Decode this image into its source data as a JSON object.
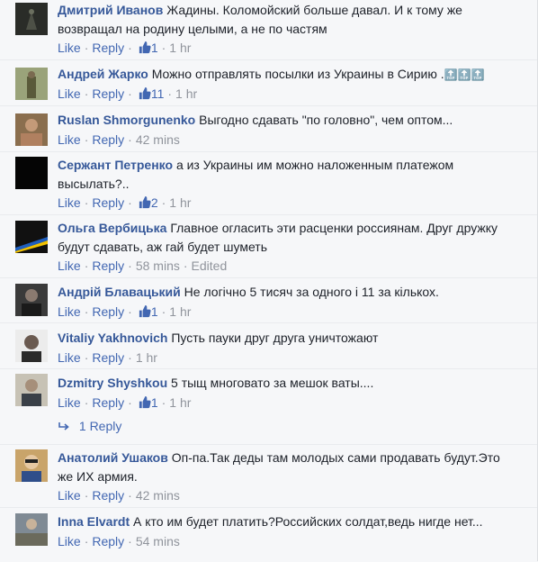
{
  "comments": [
    {
      "author": "Дмитрий Иванов",
      "text": "Жадины. Коломойский больше давал. И к тому же возвращал на родину целыми, а не по частям",
      "like": "Like",
      "reply": "Reply",
      "likes": "1",
      "time": "1 hr"
    },
    {
      "author": "Андрей Жарко",
      "text": "Можно отправлять посылки из Украины в Сирию .",
      "emoji": "🔝🔝🔝",
      "like": "Like",
      "reply": "Reply",
      "likes": "11",
      "time": "1 hr"
    },
    {
      "author": "Ruslan Shmorgunenko",
      "text": "Выгодно сдавать \"по головно\", чем оптом...",
      "like": "Like",
      "reply": "Reply",
      "time": "42 mins"
    },
    {
      "author": "Сержант Петренко",
      "text": "а из Украины им можно наложенным платежом высылать?..",
      "like": "Like",
      "reply": "Reply",
      "likes": "2",
      "time": "1 hr"
    },
    {
      "author": "Ольга Вербицька",
      "text": "Главное огласить эти расценки россиянам. Друг дружку будут сдавать, аж гай будет шуметь",
      "like": "Like",
      "reply": "Reply",
      "time": "58 mins",
      "edited": "Edited"
    },
    {
      "author": "Андрій Блавацький",
      "text": "Не логічно 5 тисяч за одного і 11 за кількох.",
      "like": "Like",
      "reply": "Reply",
      "likes": "1",
      "time": "1 hr"
    },
    {
      "author": "Vitaliy Yakhnovich",
      "text": "Пусть пауки друг друга уничтожают",
      "like": "Like",
      "reply": "Reply",
      "time": "1 hr"
    },
    {
      "author": "Dzmitry Shyshkou",
      "text": "5 тыщ многовато за мешок ваты....",
      "like": "Like",
      "reply": "Reply",
      "likes": "1",
      "time": "1 hr",
      "replies": "1 Reply"
    },
    {
      "author": "Анатолий Ушаков",
      "text": "Оп-па.Так деды там молодых сами продавать будут.Это же ИХ армия.",
      "like": "Like",
      "reply": "Reply",
      "time": "42 mins"
    },
    {
      "author": "Inna Elvardt",
      "text": "А кто им будет платить?Российских солдат,ведь нигде нет...",
      "like": "Like",
      "reply": "Reply",
      "time": "54 mins"
    }
  ],
  "colors": {
    "author": "#365899",
    "link": "#4267b2",
    "meta": "#90949c",
    "text": "#1d2129",
    "background": "#f6f7f9"
  }
}
